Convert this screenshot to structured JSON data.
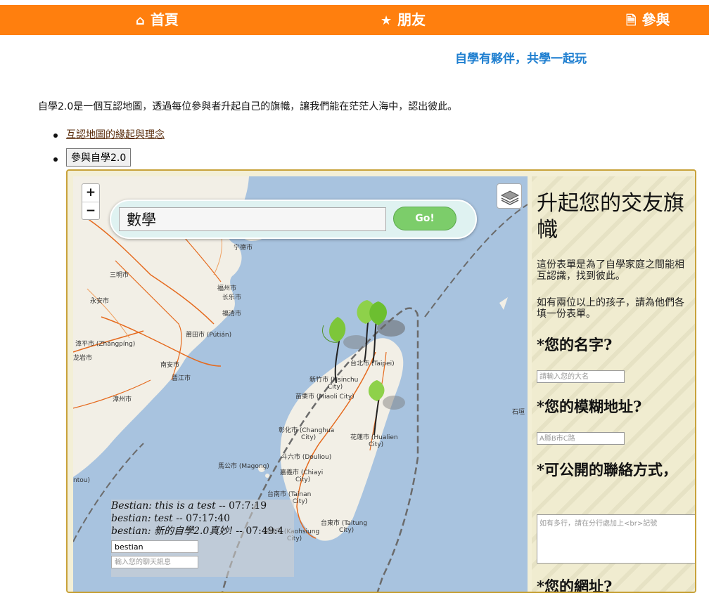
{
  "nav": {
    "home": {
      "icon": "home-icon",
      "label": "首頁"
    },
    "friends": {
      "icon": "star-icon",
      "label": "朋友"
    },
    "join": {
      "icon": "document-icon",
      "label": "參與"
    }
  },
  "tagline": "自學有夥伴，共學一起玩",
  "intro": "自學2.0是一個互認地圖，透過每位參與者升起自己的旗幟，讓我們能在茫茫人海中，認出彼此。",
  "links": {
    "origin": "互認地圖的緣起與理念",
    "join_button": "參與自學2.0"
  },
  "map": {
    "zoom_in": "+",
    "zoom_out": "−",
    "search": {
      "value": "數學",
      "button": "Go!"
    },
    "labels": {
      "fuzhou": "福州市",
      "changle": "长乐市",
      "fuqing": "福清市",
      "ningde": "宁德市",
      "sanming": "三明市",
      "yongan": "永安市",
      "putian": "莆田市 (Pútián)",
      "zhangping": "漳平市 (Zhāngpíng)",
      "longyan": "龙岩市",
      "nanan": "南安市",
      "jinjiang": "晋江市",
      "zhangzhou": "漳州市",
      "taipei": "台北市 (Taipei)",
      "hsinchu_1": "新竹市 (Hsinchu",
      "hsinchu_2": "City)",
      "miaoli": "苗栗市 (Miaoli City)",
      "changhua_1": "彰化市 (Changhua",
      "changhua_2": "City)",
      "hualien_1": "花蓮市 (Hualien",
      "hualien_2": "City)",
      "douliou": "斗六市 (Douliou)",
      "magong": "馬公市 (Magong)",
      "chiayi_1": "嘉義市 (Chiayi",
      "chiayi_2": "City)",
      "tainan_1": "台南市 (Tainan",
      "tainan_2": "City)",
      "kaohsiung_1": "高雄市 (Kaohsiung",
      "kaohsiung_2": "City)",
      "taitung_1": "台東市 (Taitung",
      "taitung_2": "City)",
      "ishigaki": "石垣",
      "toutou": "ntou)"
    }
  },
  "chat": {
    "messages": [
      {
        "text": "Bestian: this is a test",
        "time": " -- 07:7:19"
      },
      {
        "text": "bestian: test",
        "time": " -- 07:17:40"
      },
      {
        "text": "bestian: 新的自學2.0真妙!",
        "time": " -- 07:49:4"
      }
    ],
    "name_value": "bestian",
    "message_placeholder": "輸入您的聊天訊息"
  },
  "form": {
    "title": "升起您的交友旗幟",
    "desc1": "這份表單是為了自學家庭之間能相互認識，找到彼此。",
    "desc2": "如有兩位以上的孩子，請為他們各填一份表單。",
    "name_label": "*您的名字?",
    "name_placeholder": "請輸入您的大名",
    "address_label": "*您的模糊地址?",
    "address_placeholder": "A縣B市C路",
    "contact_label": "*可公開的聯絡方式，",
    "contact_placeholder": "如有多行，請在分行處加上<br>記號",
    "website_label": "*您的網址?"
  }
}
